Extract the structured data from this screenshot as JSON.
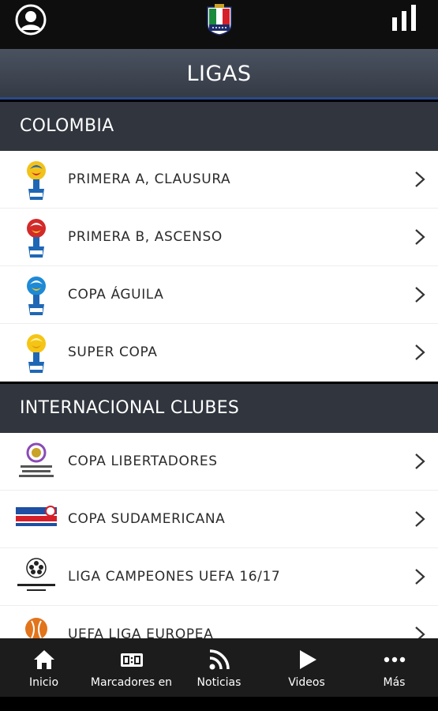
{
  "header": {
    "title": "LIGAS",
    "profile_icon": "user-circle-icon",
    "logo_icon": "crest-logo",
    "stats_icon": "bar-chart-icon"
  },
  "sections": [
    {
      "title": "COLOMBIA",
      "items": [
        {
          "label": "PRIMERA A, CLAUSURA",
          "icon": "trophy-yellow-icon"
        },
        {
          "label": "PRIMERA B, ASCENSO",
          "icon": "trophy-red-icon"
        },
        {
          "label": "COPA ÁGUILA",
          "icon": "trophy-blue-icon"
        },
        {
          "label": "SUPER COPA",
          "icon": "trophy-gold-icon"
        }
      ]
    },
    {
      "title": "INTERNACIONAL CLUBES",
      "items": [
        {
          "label": "COPA LIBERTADORES",
          "icon": "libertadores-icon"
        },
        {
          "label": "COPA SUDAMERICANA",
          "icon": "sudamericana-icon"
        },
        {
          "label": "LIGA CAMPEONES UEFA 16/17",
          "icon": "champions-league-icon"
        },
        {
          "label": "UEFA LIGA EUROPEA",
          "icon": "europa-league-icon"
        }
      ]
    }
  ],
  "nav": [
    {
      "label": "Inicio",
      "icon": "home-icon"
    },
    {
      "label": "Marcadores en",
      "icon": "scoreboard-icon"
    },
    {
      "label": "Noticias",
      "icon": "rss-icon"
    },
    {
      "label": "Videos",
      "icon": "play-icon"
    },
    {
      "label": "Más",
      "icon": "more-dots-icon"
    }
  ]
}
